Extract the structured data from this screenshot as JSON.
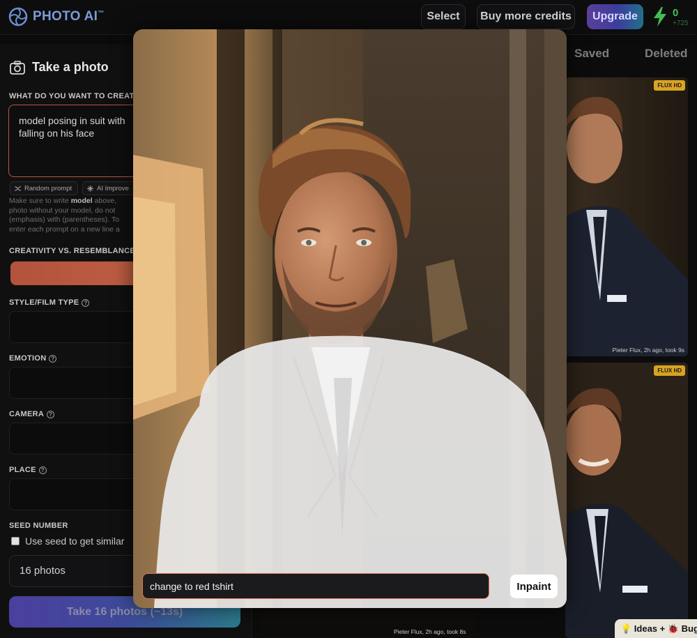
{
  "header": {
    "logo_text": "PHOTO AI",
    "logo_tm": "™",
    "select_label": "Select",
    "buy_credits_label": "Buy more credits",
    "upgrade_label": "Upgrade",
    "credits_value": "0",
    "credits_sub": "+725"
  },
  "left_panel": {
    "title": "Take a photo",
    "prompt_label": "WHAT DO YOU WANT TO CREAT",
    "prompt_value_line1": "model posing in suit with",
    "prompt_value_line2": "falling on his face",
    "random_prompt_label": "Random prompt",
    "ai_improve_label": "AI Improve",
    "hint_prefix": "Make sure to write ",
    "hint_bold": "model",
    "hint_suffix": " above,",
    "hint_line2": "photo without your model, do not",
    "hint_line3": "(emphasis) with (parentheses). To",
    "hint_line4": "enter each prompt on a new line a",
    "creativity_label": "CREATIVITY VS. RESEMBLANCE",
    "style_label": "STYLE/FILM TYPE",
    "emotion_label": "EMOTION",
    "camera_label": "CAMERA",
    "place_label": "PLACE",
    "seed_label": "SEED NUMBER",
    "seed_checkbox_label": "Use seed to get similar",
    "photos_count": "16 photos",
    "take_button_label": "Take 16 photos (~13s)"
  },
  "gallery": {
    "tabs": [
      "Saved",
      "Deleted"
    ],
    "cards": [
      {
        "badge": "FLUX HD",
        "meta": "Pieter Flux, 2h ago, took 9s"
      },
      {
        "badge": "FLUX HD",
        "meta": ""
      },
      {
        "badge": "",
        "meta": "Pieter Flux, 2h ago, took 8s"
      }
    ],
    "ideas_label": "💡 Ideas + 🐞 Bugs"
  },
  "modal": {
    "inpaint_prompt": "change to red tshirt",
    "inpaint_button_label": "Inpaint"
  },
  "colors": {
    "accent_orange": "#e0714f",
    "credit_green": "#43c057",
    "flux_badge": "#d9a322"
  }
}
